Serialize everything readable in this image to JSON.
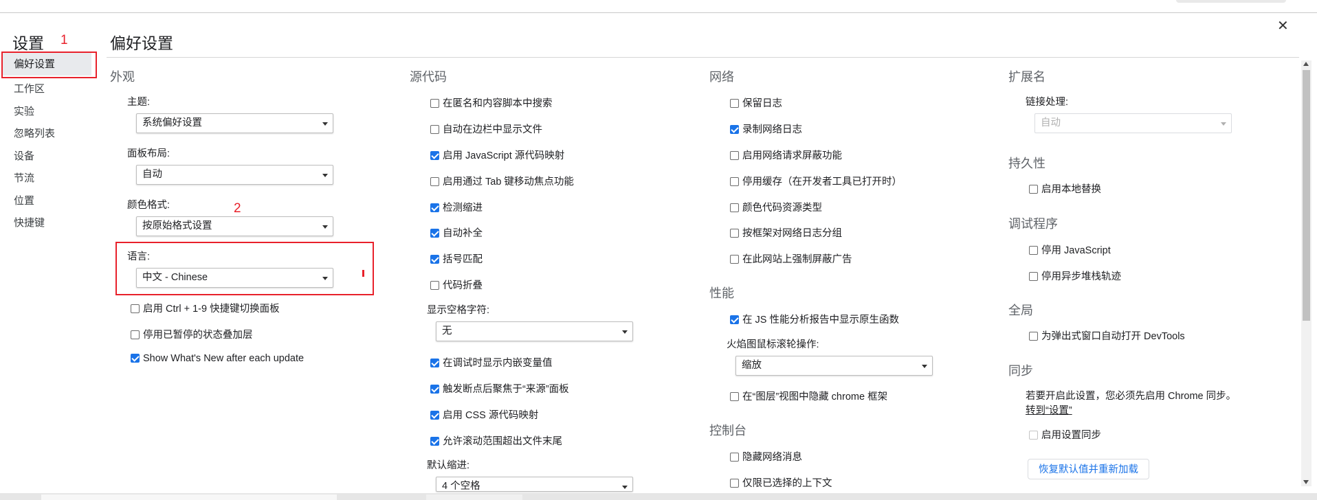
{
  "sidebar": {
    "title": "设置",
    "items": [
      "偏好设置",
      "工作区",
      "实验",
      "忽略列表",
      "设备",
      "节流",
      "位置",
      "快捷键"
    ]
  },
  "annotations": {
    "n1": "1",
    "n2": "2"
  },
  "main": {
    "title": "偏好设置",
    "appearance": {
      "title": "外观",
      "theme_label": "主题:",
      "theme_value": "系统偏好设置",
      "panel_label": "面板布局:",
      "panel_value": "自动",
      "color_label": "颜色格式:",
      "color_value": "按原始格式设置",
      "lang_label": "语言:",
      "lang_value": "中文 - Chinese",
      "checkboxes": [
        {
          "label": "启用 Ctrl + 1-9 快捷键切换面板",
          "checked": false
        },
        {
          "label": "停用已暂停的状态叠加层",
          "checked": false
        },
        {
          "label": "Show What's New after each update",
          "checked": true
        }
      ]
    },
    "sources": {
      "title": "源代码",
      "checkboxes": [
        {
          "label": "在匿名和内容脚本中搜索",
          "checked": false
        },
        {
          "label": "自动在边栏中显示文件",
          "checked": false
        },
        {
          "label": "启用 JavaScript 源代码映射",
          "checked": true
        },
        {
          "label": "启用通过 Tab 键移动焦点功能",
          "checked": false
        },
        {
          "label": "检测缩进",
          "checked": true
        },
        {
          "label": "自动补全",
          "checked": true
        },
        {
          "label": "括号匹配",
          "checked": true
        },
        {
          "label": "代码折叠",
          "checked": false
        }
      ],
      "whitespace_label": "显示空格字符:",
      "whitespace_value": "无",
      "checkboxes2": [
        {
          "label": "在调试时显示内嵌变量值",
          "checked": true
        },
        {
          "label": "触发断点后聚焦于“来源”面板",
          "checked": true
        },
        {
          "label": "启用 CSS 源代码映射",
          "checked": true
        },
        {
          "label": "允许滚动范围超出文件末尾",
          "checked": true
        }
      ],
      "indent_label": "默认缩进:",
      "indent_value": "4 个空格"
    },
    "network": {
      "title": "网络",
      "checkboxes": [
        {
          "label": "保留日志",
          "checked": false
        },
        {
          "label": "录制网络日志",
          "checked": true
        },
        {
          "label": "启用网络请求屏蔽功能",
          "checked": false
        },
        {
          "label": "停用缓存（在开发者工具已打开时）",
          "checked": false
        },
        {
          "label": "颜色代码资源类型",
          "checked": false
        },
        {
          "label": "按框架对网络日志分组",
          "checked": false
        },
        {
          "label": "在此网站上强制屏蔽广告",
          "checked": false
        }
      ]
    },
    "performance": {
      "title": "性能",
      "checkbox": {
        "label": "在 JS 性能分析报告中显示原生函数",
        "checked": true
      },
      "flame_label": "火焰图鼠标滚轮操作:",
      "flame_value": "缩放",
      "checkbox2": {
        "label": "在“图层”视图中隐藏 chrome 框架",
        "checked": false
      }
    },
    "console": {
      "title": "控制台",
      "checkboxes": [
        {
          "label": "隐藏网络消息",
          "checked": false
        },
        {
          "label": "仅限已选择的上下文",
          "checked": false
        }
      ]
    },
    "extensions": {
      "title": "扩展名",
      "link_label": "链接处理:",
      "link_value": "自动"
    },
    "persistence": {
      "title": "持久性",
      "checkbox": {
        "label": "启用本地替换",
        "checked": false
      }
    },
    "debugger": {
      "title": "调试程序",
      "checkboxes": [
        {
          "label": "停用 JavaScript",
          "checked": false
        },
        {
          "label": "停用异步堆栈轨迹",
          "checked": false
        }
      ]
    },
    "global": {
      "title": "全局",
      "checkbox": {
        "label": "为弹出式窗口自动打开 DevTools",
        "checked": false
      }
    },
    "sync": {
      "title": "同步",
      "text": "若要开启此设置，您必须先启用 Chrome 同步。",
      "link": "转到“设置”",
      "checkbox": {
        "label": "启用设置同步",
        "checked": false
      }
    },
    "reset_button": "恢复默认值并重新加载"
  },
  "colors": {
    "accent": "#1a73e8",
    "annotation": "#e8202a"
  }
}
